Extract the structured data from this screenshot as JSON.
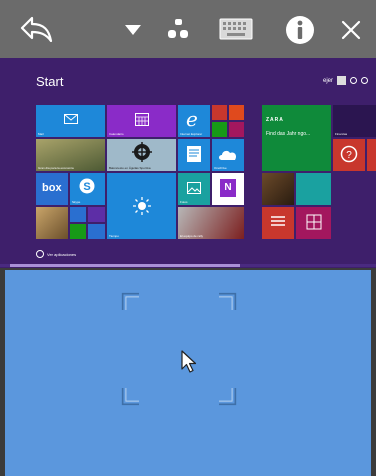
{
  "toolbar": {
    "icons": [
      "back-icon",
      "dropdown-icon",
      "mouse-icon",
      "keyboard-icon",
      "info-icon",
      "close-icon"
    ]
  },
  "screen": {
    "title": "Start",
    "user_name": "ejer",
    "all_apps_label": "Ver aplicaciones",
    "tiles": {
      "mail": "Mail",
      "calendar": "Calendario",
      "ie": "Internet Explorer",
      "news_headline": "Gran día para la economía",
      "maps_caption": "Baloncesto en Águilas Sportiva",
      "store": "Store",
      "onedrive": "OneDrive",
      "skype": "Skype",
      "weather": "Tiempo",
      "photos": "Fotos",
      "fashion_text": "Find das Jahr ngo...",
      "fashion_brand": "ZARA",
      "video_caption": "El equipo de rally",
      "finance": "Finanzas"
    }
  },
  "colors": {
    "toolbar": "#6b6b6b",
    "screen_bg": "#3e1f6b",
    "touchpad": "#5b97dd",
    "tile_blue": "#1e88d9",
    "tile_green": "#00a300",
    "tile_red": "#c8372d"
  }
}
